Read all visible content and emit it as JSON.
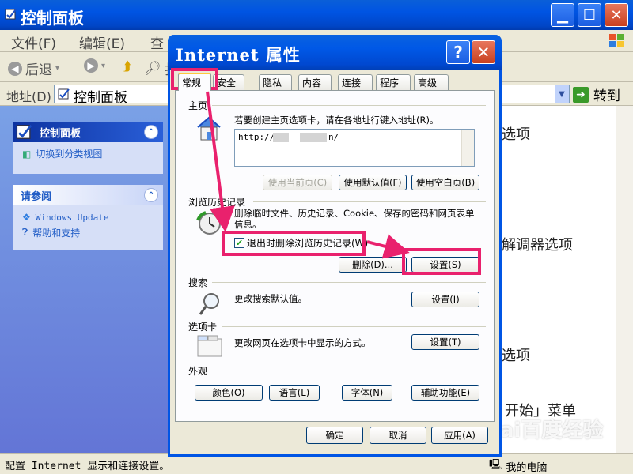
{
  "control_panel": {
    "title": "控制面板",
    "menu": [
      "文件(F)",
      "编辑(E)",
      "查"
    ],
    "toolbar": {
      "back": "后退",
      "search_partial": "扌"
    },
    "address": {
      "label": "地址(D)",
      "value": "控制面板",
      "go": "转到"
    },
    "left_pane": {
      "panel1": {
        "title": "控制面板",
        "link": "切换到分类视图"
      },
      "panel2": {
        "title": "请参阅",
        "links": [
          "Windows Update",
          "帮助和支持"
        ]
      }
    },
    "background_text": [
      "选项",
      "解调器选项",
      "选项",
      "开始」菜单"
    ],
    "status": {
      "text": "配置 Internet 显示和连接设置。",
      "zone": "我的电脑"
    },
    "watermark": "Bai百度经验"
  },
  "dialog": {
    "title": "Internet 属性",
    "help": "?",
    "close": "✕",
    "tabs": [
      "常规",
      "安全",
      "隐私",
      "内容",
      "连接",
      "程序",
      "高级"
    ],
    "home": {
      "label": "主页",
      "desc": "若要创建主页选项卡，请在各地址行键入地址(R)。",
      "url_prefix": "http://",
      "url_suffix": "n/",
      "buttons": [
        "使用当前页(C)",
        "使用默认值(F)",
        "使用空白页(B)"
      ]
    },
    "history": {
      "label": "浏览历史记录",
      "desc": "删除临时文件、历史记录、Cookie、保存的密码和网页表单信息。",
      "checkbox_label": "退出时删除浏览历史记录(W)",
      "checked": true,
      "delete_button": "删除(D)...",
      "settings_button": "设置(S)"
    },
    "search": {
      "label": "搜索",
      "desc": "更改搜索默认值。",
      "button": "设置(I)"
    },
    "tabs_section": {
      "label": "选项卡",
      "desc": "更改网页在选项卡中显示的方式。",
      "button": "设置(T)"
    },
    "appearance": {
      "label": "外观",
      "buttons": [
        "颜色(O)",
        "语言(L)",
        "字体(N)",
        "辅助功能(E)"
      ]
    },
    "footer": {
      "ok": "确定",
      "cancel": "取消",
      "apply": "应用(A)"
    }
  },
  "colors": {
    "highlight": "#e9216d",
    "titlebar": "#0054e3",
    "pane": "#6f8be0"
  }
}
